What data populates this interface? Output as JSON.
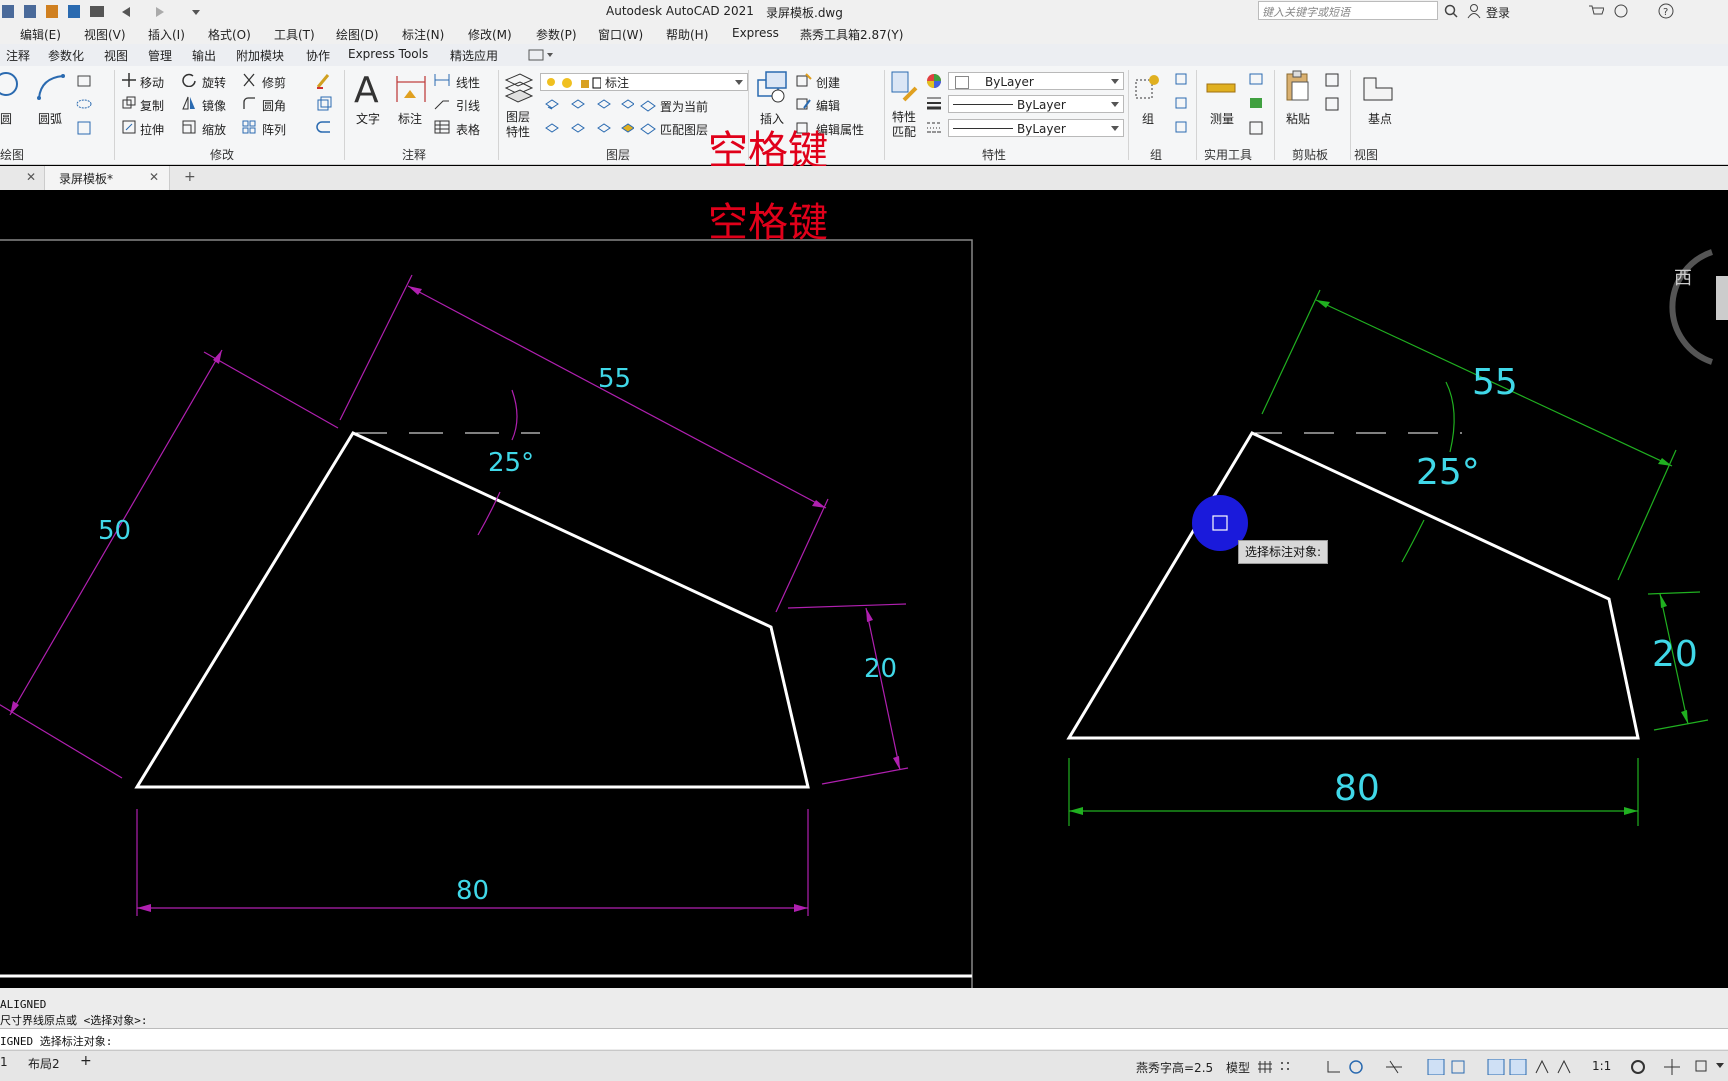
{
  "title": {
    "app": "Autodesk AutoCAD 2021",
    "file": "录屏模板.dwg",
    "search_placeholder": "键入关键字或短语",
    "login": "登录"
  },
  "menu": [
    "编辑(E)",
    "视图(V)",
    "插入(I)",
    "格式(O)",
    "工具(T)",
    "绘图(D)",
    "标注(N)",
    "修改(M)",
    "参数(P)",
    "窗口(W)",
    "帮助(H)",
    "Express",
    "燕秀工具箱2.87(Y)"
  ],
  "ribbon_tabs": [
    "注释",
    "参数化",
    "视图",
    "管理",
    "输出",
    "附加模块",
    "协作",
    "Express Tools",
    "精选应用"
  ],
  "ribbon": {
    "draw": {
      "circle": "圆",
      "arc": "圆弧",
      "panel": "绘图"
    },
    "modify": {
      "move": "移动",
      "rotate": "旋转",
      "trim": "修剪",
      "copy": "复制",
      "mirror": "镜像",
      "fillet": "圆角",
      "stretch": "拉伸",
      "scale": "缩放",
      "array": "阵列",
      "panel": "修改"
    },
    "annotation": {
      "text": "文字",
      "dimension": "标注",
      "linear": "线性",
      "leader": "引线",
      "table": "表格",
      "panel": "注释"
    },
    "layers": {
      "props": "图层特性",
      "current_layer": "标注",
      "set_current": "置为当前",
      "match": "匹配图层",
      "panel": "图层"
    },
    "block": {
      "insert": "插入",
      "create": "创建",
      "edit": "编辑",
      "edit_attr": "编辑属性"
    },
    "properties": {
      "match": "特性匹配",
      "color": "ByLayer",
      "linetype": "ByLayer",
      "lineweight": "ByLayer",
      "panel": "特性"
    },
    "groups": {
      "group": "组",
      "panel": "组"
    },
    "utilities": {
      "measure": "测量",
      "panel": "实用工具"
    },
    "clipboard": {
      "paste": "粘贴",
      "panel": "剪贴板"
    },
    "view": {
      "base": "基点",
      "panel": "视图"
    }
  },
  "file_tab": "录屏模板*",
  "overlay_text": "空格键",
  "drawing_left": {
    "dims": {
      "top": "55",
      "left": "50",
      "angle": "25°",
      "right": "20",
      "bottom": "80"
    }
  },
  "drawing_right": {
    "dims": {
      "top": "55",
      "angle": "25°",
      "right": "20",
      "bottom": "80"
    },
    "tooltip": "选择标注对象:"
  },
  "viewcube_label": "西",
  "command": {
    "line1": "ALIGNED",
    "line2": "尺寸界线原点或 <选择对象>:",
    "input": "IGNED 选择标注对象:"
  },
  "layout_tabs": [
    "1",
    "布局2"
  ],
  "statusbar": {
    "text_height": "燕秀字高=2.5",
    "model": "模型",
    "scale": "1:1"
  },
  "colors": {
    "magenta": "#b020b0",
    "cyan": "#40d8e8",
    "green": "#20b020",
    "white": "#ffffff",
    "red": "#e0001a",
    "blue": "#1a1adb"
  }
}
